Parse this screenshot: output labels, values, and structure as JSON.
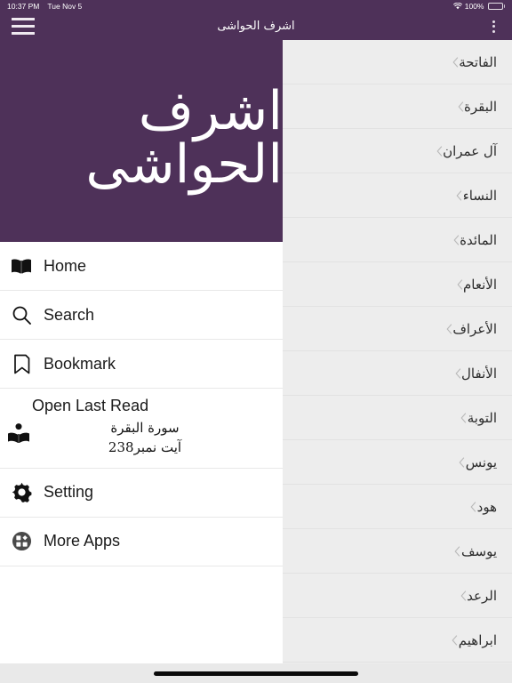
{
  "colors": {
    "brand_purple": "#4E3159",
    "list_bg": "#EDEDED",
    "drawer_bg": "#FFFFFF",
    "divider": "#E8E8E8",
    "chevron": "#B9B9B9",
    "text": "#1A1A1A"
  },
  "status_bar": {
    "time": "10:37 PM",
    "date": "Tue Nov 5",
    "battery_percent": "100%",
    "wifi_icon": "wifi-icon",
    "battery_icon": "battery-icon"
  },
  "navbar": {
    "menu_icon": "hamburger-menu-icon",
    "title": "اشرف الحواشی",
    "overflow_icon": "kebab-menu-icon"
  },
  "drawer": {
    "brand_title": "اشرف الحواشی",
    "menu_items": [
      {
        "label": "Home",
        "icon": "open-book-icon"
      },
      {
        "label": "Search",
        "icon": "search-icon"
      },
      {
        "label": "Bookmark",
        "icon": "bookmark-icon"
      }
    ],
    "last_read": {
      "title": "Open Last Read",
      "icon": "person-reading-icon",
      "surah": "سورة البقرة",
      "ayah": "آیت نمبر238"
    },
    "footer_items": [
      {
        "label": "Setting",
        "icon": "gear-icon"
      },
      {
        "label": "More Apps",
        "icon": "grid-apps-icon"
      }
    ]
  },
  "surah_list": {
    "chevron_icon": "chevron-right-icon",
    "items": [
      {
        "name": "الفاتحة"
      },
      {
        "name": "البقرة"
      },
      {
        "name": "آل عمران"
      },
      {
        "name": "النساء"
      },
      {
        "name": "المائدة"
      },
      {
        "name": "الأنعام"
      },
      {
        "name": "الأعراف"
      },
      {
        "name": "الأنفال"
      },
      {
        "name": "التوبة"
      },
      {
        "name": "يونس"
      },
      {
        "name": "هود"
      },
      {
        "name": "يوسف"
      },
      {
        "name": "الرعد"
      },
      {
        "name": "ابراهيم"
      }
    ]
  },
  "home_indicator": {
    "label": "home-indicator"
  }
}
